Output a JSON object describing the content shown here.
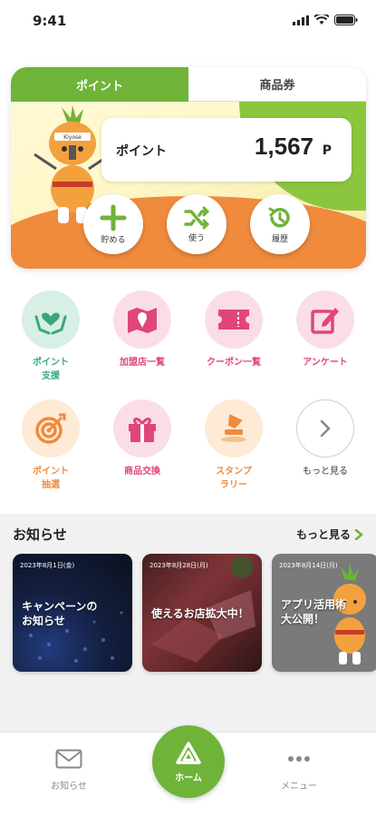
{
  "status": {
    "time": "9:41"
  },
  "card": {
    "tabs": [
      {
        "label": "ポイント"
      },
      {
        "label": "商品券"
      }
    ],
    "point_label": "ポイント",
    "point_value": "1,567",
    "point_unit": "P",
    "actions": [
      {
        "label": "貯める"
      },
      {
        "label": "使う"
      },
      {
        "label": "履歴"
      }
    ]
  },
  "menu": [
    {
      "label": "ポイント\n支援",
      "color": "#3aa77a",
      "bg": "#d7efe4"
    },
    {
      "label": "加盟店一覧",
      "color": "#e0457b",
      "bg": "#fbdde6"
    },
    {
      "label": "クーポン一覧",
      "color": "#e0457b",
      "bg": "#fbdde6"
    },
    {
      "label": "アンケート",
      "color": "#e0457b",
      "bg": "#fbdde6"
    },
    {
      "label": "ポイント\n抽選",
      "color": "#f08a3c",
      "bg": "#fdebd6"
    },
    {
      "label": "商品交換",
      "color": "#e0457b",
      "bg": "#fbdde6"
    },
    {
      "label": "スタンプ\nラリー",
      "color": "#f08a3c",
      "bg": "#fdebd6"
    },
    {
      "label": "もっと見る",
      "color": "#333333",
      "bg": "#ffffff"
    }
  ],
  "news": {
    "header": "お知らせ",
    "more": "もっと見る",
    "items": [
      {
        "date": "2023年8月1日(金)",
        "title": "キャンペーンの\nお知らせ"
      },
      {
        "date": "2023年8月28日(月)",
        "title": "使えるお店拡大中！"
      },
      {
        "date": "2023年8月14日(月)",
        "title": "アプリ活用術\n大公開！"
      }
    ]
  },
  "tabbar": {
    "notices": "お知らせ",
    "home": "ホーム",
    "menu": "メニュー"
  },
  "colors": {
    "green": "#6fb339",
    "orange": "#f08a3c",
    "pink": "#e0457b",
    "teal": "#3aa77a"
  }
}
